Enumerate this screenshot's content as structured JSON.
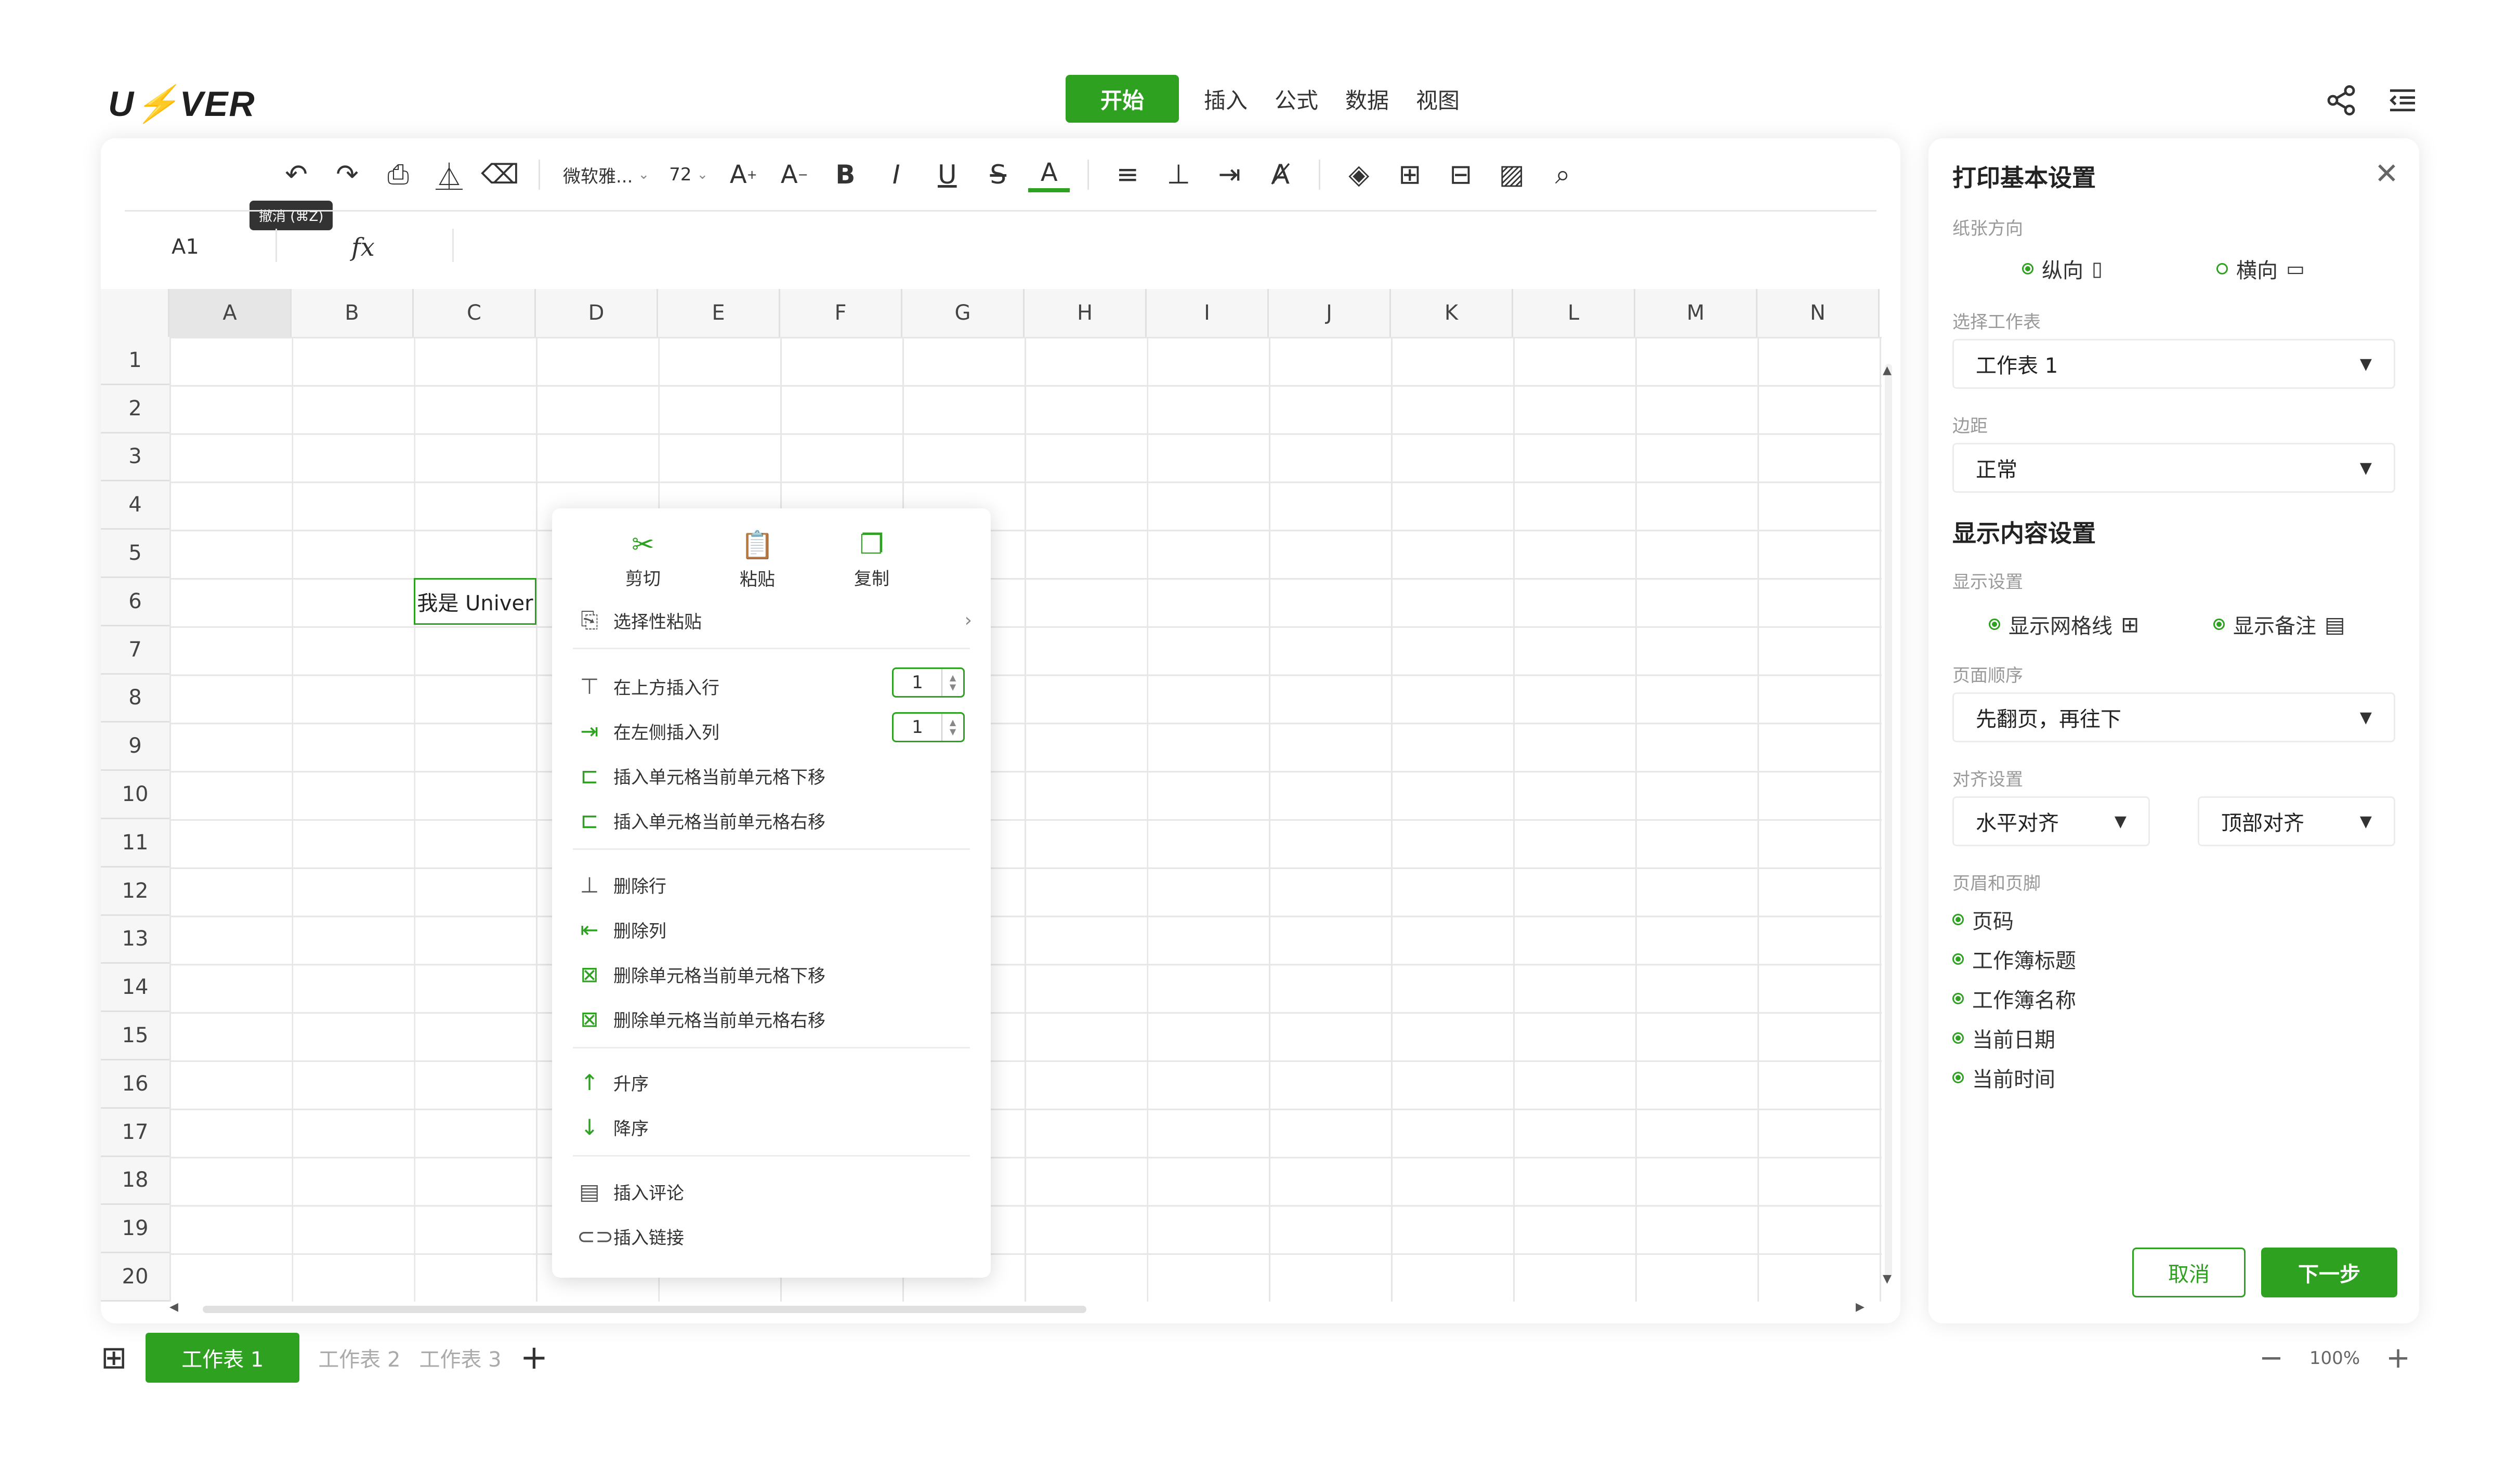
{
  "app": {
    "logo": "U",
    "logo_bolt": "⚡",
    "logo_rest": "VER"
  },
  "menu": {
    "start": "开始",
    "tabs": [
      "插入",
      "公式",
      "数据",
      "视图"
    ]
  },
  "toolbar": {
    "font_name": "微软雅...",
    "font_size": "72",
    "tooltip": "撤消 (⌘Z)"
  },
  "formula_bar": {
    "cell_ref": "A1",
    "fx": "fx"
  },
  "grid": {
    "columns": [
      "A",
      "B",
      "C",
      "D",
      "E",
      "F",
      "G",
      "H",
      "I",
      "J",
      "K",
      "L",
      "M",
      "N"
    ],
    "rows": [
      "1",
      "2",
      "3",
      "4",
      "5",
      "6",
      "7",
      "8",
      "9",
      "10",
      "11",
      "12",
      "13",
      "14",
      "15",
      "16",
      "17",
      "18",
      "19",
      "20"
    ],
    "selected_column": "A",
    "cell_text": "我是 Univer"
  },
  "context_menu": {
    "top": [
      {
        "label": "剪切",
        "icon": "scissors-icon"
      },
      {
        "label": "粘贴",
        "icon": "paste-icon"
      },
      {
        "label": "复制",
        "icon": "copy-icon"
      }
    ],
    "special_paste": "选择性粘贴",
    "insert_row_above": "在上方插入行",
    "insert_row_value": "1",
    "insert_col_left": "在左侧插入列",
    "insert_col_value": "1",
    "insert_shift_down": "插入单元格当前单元格下移",
    "insert_shift_right": "插入单元格当前单元格右移",
    "delete_row": "删除行",
    "delete_col": "删除列",
    "delete_shift_down": "删除单元格当前单元格下移",
    "delete_shift_right": "删除单元格当前单元格右移",
    "sort_asc": "升序",
    "sort_desc": "降序",
    "insert_comment": "插入评论",
    "insert_link": "插入链接"
  },
  "sheets": {
    "active": "工作表 1",
    "others": [
      "工作表 2",
      "工作表 3"
    ]
  },
  "zoom": {
    "value": "100%"
  },
  "print_panel": {
    "title": "打印基本设置",
    "orientation_label": "纸张方向",
    "portrait": "纵向",
    "landscape": "横向",
    "sheet_label": "选择工作表",
    "sheet_value": "工作表 1",
    "margin_label": "边距",
    "margin_value": "正常",
    "display_title": "显示内容设置",
    "display_label": "显示设置",
    "show_gridlines": "显示网格线",
    "show_comments": "显示备注",
    "page_order_label": "页面顺序",
    "page_order_value": "先翻页，再往下",
    "align_label": "对齐设置",
    "align_h": "水平对齐",
    "align_v": "顶部对齐",
    "header_footer_label": "页眉和页脚",
    "header_footer_items": [
      "页码",
      "工作簿标题",
      "工作簿名称",
      "当前日期",
      "当前时间"
    ],
    "cancel": "取消",
    "next": "下一步"
  },
  "colors": {
    "accent": "#2ea121"
  }
}
